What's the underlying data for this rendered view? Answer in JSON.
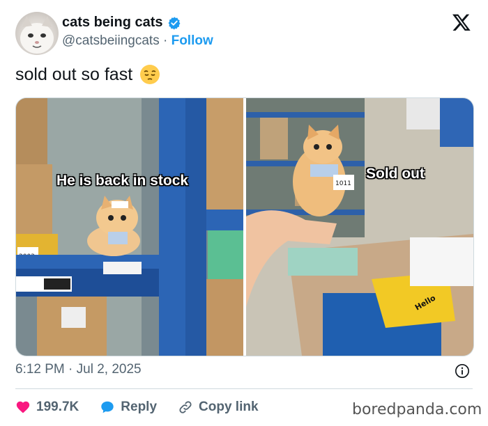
{
  "author": {
    "display_name": "cats being cats",
    "handle": "@catsbeiingcats",
    "separator": "·",
    "follow_label": "Follow",
    "verified": true,
    "verified_color": "#1d9bf0"
  },
  "tweet": {
    "text": "sold out so fast",
    "emoji": "pensive-face-emoji"
  },
  "media": {
    "photos": [
      {
        "caption": "He is back in stock",
        "labels": {
          "box_number": "2003"
        }
      },
      {
        "caption": "Sold out",
        "labels": {
          "tag": "1011",
          "bag_text": "Hello"
        }
      }
    ]
  },
  "meta": {
    "timestamp": "6:12 PM · Jul 2, 2025"
  },
  "actions": {
    "likes": "199.7K",
    "reply_label": "Reply",
    "copy_link_label": "Copy link",
    "like_color": "#f91880",
    "reply_color": "#1d9bf0"
  },
  "watermark": "boredpanda.com"
}
